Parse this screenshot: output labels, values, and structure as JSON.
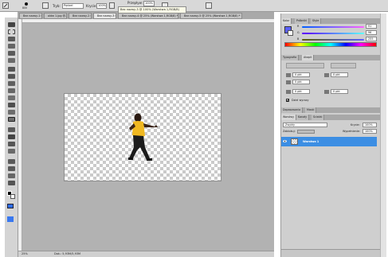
{
  "options_bar": {
    "brush_size": "800",
    "mode_label": "Tryb:",
    "mode_value": "Pędzel",
    "opacity_label": "Krycie:",
    "opacity_value": "100%",
    "flow_label": "Przepływ:",
    "flow_value": "100%"
  },
  "tooltip": "Bez nazwy-3 @ 100% (Warstwa 1,RGB/8)",
  "doc_tabs": [
    {
      "label": "Bez nazwy-1 @..."
    },
    {
      "label": "oldw 1.jpg @..."
    },
    {
      "label": "Bez nazwy-2 @..."
    },
    {
      "label": "Bez nazwy-3 @..."
    },
    {
      "label": "Bez nazwy-4 @ 25% (Warstwa 1,RGB/8) *"
    },
    {
      "label": "Bez nazwy-5 @ 25% (Warstwa 1,RGB/8) *"
    }
  ],
  "status_bar": {
    "zoom": "25%",
    "doc_info": "Dok.: 5,93M/5,93M"
  },
  "color_panel": {
    "tabs": [
      "Kolor",
      "Próbniki",
      "Style"
    ],
    "r_label": "R",
    "r_value": "91",
    "g_label": "G",
    "g_value": "96",
    "b_label": "B",
    "b_value": "255",
    "foreground_color": "#5b60ff"
  },
  "paragraph_panel": {
    "tabs": [
      "Typografia",
      "Akapit"
    ],
    "indent_left": "0 pkt",
    "indent_right": "0 pkt",
    "indent_first": "0 pkt",
    "space_before": "0 pkt",
    "space_after": "0 pkt",
    "hyphenation_label": "Dziel wyrazy"
  },
  "adjustments_tabs": [
    "Dopasowania",
    "Maski"
  ],
  "layers_panel": {
    "tabs": [
      "Warstwy",
      "Kanały",
      "Ścieżki"
    ],
    "blend_mode": "Zwykły",
    "opacity_label": "Krycie:",
    "opacity_value": "100%",
    "lock_label": "Zablokuj:",
    "fill_label": "Wypełnienie:",
    "fill_value": "100%",
    "layer_name": "Warstwa 1",
    "selection_color": "#3c8ee3"
  }
}
